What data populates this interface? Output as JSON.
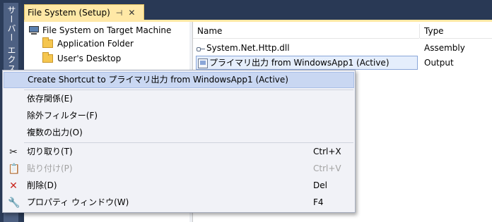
{
  "side_panel": {
    "tab_label": "サーバー エクスプローラー"
  },
  "doc_tab": {
    "title": "File System (Setup)",
    "pin_glyph": "⊣",
    "close_glyph": "✕"
  },
  "tree": {
    "root": "File System on Target Machine",
    "items": [
      "Application Folder",
      "User's Desktop"
    ]
  },
  "list": {
    "columns": [
      "Name",
      "Type"
    ],
    "rows": [
      {
        "name": "System.Net.Http.dll",
        "type": "Assembly",
        "icon": "dll-icon",
        "selected": false
      },
      {
        "name": "プライマリ出力 from WindowsApp1 (Active)",
        "type": "Output",
        "icon": "output-icon",
        "selected": true
      }
    ]
  },
  "context_menu": {
    "items": [
      {
        "label": "Create Shortcut to プライマリ出力 from WindowsApp1 (Active)",
        "shortcut": "",
        "icon": "",
        "highlighted": true,
        "enabled": true
      },
      {
        "label": "依存関係(E)",
        "shortcut": "",
        "icon": "",
        "enabled": true
      },
      {
        "label": "除外フィルター(F)",
        "shortcut": "",
        "icon": "",
        "enabled": true
      },
      {
        "label": "複数の出力(O)",
        "shortcut": "",
        "icon": "",
        "enabled": true
      },
      {
        "label": "切り取り(T)",
        "shortcut": "Ctrl+X",
        "icon": "scissors-icon",
        "enabled": true
      },
      {
        "label": "貼り付け(P)",
        "shortcut": "Ctrl+V",
        "icon": "clipboard-icon",
        "enabled": false
      },
      {
        "label": "削除(D)",
        "shortcut": "Del",
        "icon": "delete-icon",
        "enabled": true
      },
      {
        "label": "プロパティ ウィンドウ(W)",
        "shortcut": "F4",
        "icon": "wrench-icon",
        "enabled": true
      }
    ]
  },
  "colors": {
    "ide_background": "#293955",
    "tab_active": "#ffe8a6",
    "menu_highlight": "#c9d7f2",
    "delete_icon": "#c9261d"
  }
}
